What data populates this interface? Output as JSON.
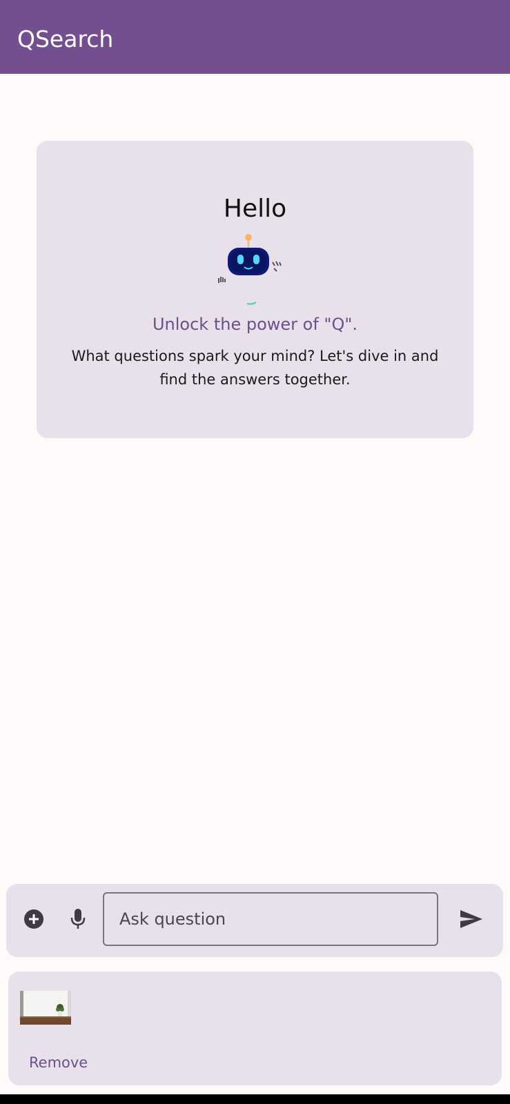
{
  "app": {
    "title": "QSearch",
    "accent_color": "#734f8f"
  },
  "welcome": {
    "greeting": "Hello",
    "mascot_icon": "robot-mascot-icon",
    "tagline": "Unlock the power of \"Q\".",
    "description": "What questions spark your mind? Let's dive in and find the answers together."
  },
  "composer": {
    "add_icon": "add-circle-icon",
    "mic_icon": "microphone-icon",
    "placeholder": "Ask question",
    "value": "",
    "send_icon": "send-icon"
  },
  "attachment": {
    "thumbnail_icon": "image-thumbnail",
    "remove_label": "Remove"
  }
}
